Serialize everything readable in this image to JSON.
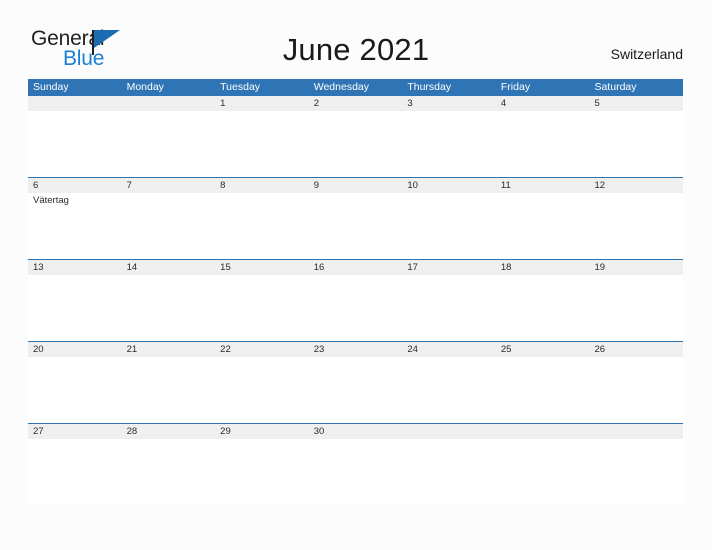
{
  "brand": {
    "name_part1": "General",
    "name_part2": "Blue",
    "flag_icon": "blue-triangle-flag-icon",
    "color_dark": "#231f20",
    "color_blue": "#1b7fd4"
  },
  "header": {
    "title": "June 2021",
    "country": "Switzerland"
  },
  "theme": {
    "header_blue": "#2f74b5",
    "date_band_gray": "#efefef",
    "page_background": "#fcfcfc",
    "text_color": "#2b2b2b"
  },
  "calendar": {
    "month": "June",
    "year": "2021",
    "weekdays": [
      "Sunday",
      "Monday",
      "Tuesday",
      "Wednesday",
      "Thursday",
      "Friday",
      "Saturday"
    ],
    "weeks": [
      [
        {
          "day": "",
          "event": ""
        },
        {
          "day": "",
          "event": ""
        },
        {
          "day": "1",
          "event": ""
        },
        {
          "day": "2",
          "event": ""
        },
        {
          "day": "3",
          "event": ""
        },
        {
          "day": "4",
          "event": ""
        },
        {
          "day": "5",
          "event": ""
        }
      ],
      [
        {
          "day": "6",
          "event": "Vätertag"
        },
        {
          "day": "7",
          "event": ""
        },
        {
          "day": "8",
          "event": ""
        },
        {
          "day": "9",
          "event": ""
        },
        {
          "day": "10",
          "event": ""
        },
        {
          "day": "11",
          "event": ""
        },
        {
          "day": "12",
          "event": ""
        }
      ],
      [
        {
          "day": "13",
          "event": ""
        },
        {
          "day": "14",
          "event": ""
        },
        {
          "day": "15",
          "event": ""
        },
        {
          "day": "16",
          "event": ""
        },
        {
          "day": "17",
          "event": ""
        },
        {
          "day": "18",
          "event": ""
        },
        {
          "day": "19",
          "event": ""
        }
      ],
      [
        {
          "day": "20",
          "event": ""
        },
        {
          "day": "21",
          "event": ""
        },
        {
          "day": "22",
          "event": ""
        },
        {
          "day": "23",
          "event": ""
        },
        {
          "day": "24",
          "event": ""
        },
        {
          "day": "25",
          "event": ""
        },
        {
          "day": "26",
          "event": ""
        }
      ],
      [
        {
          "day": "27",
          "event": ""
        },
        {
          "day": "28",
          "event": ""
        },
        {
          "day": "29",
          "event": ""
        },
        {
          "day": "30",
          "event": ""
        },
        {
          "day": "",
          "event": ""
        },
        {
          "day": "",
          "event": ""
        },
        {
          "day": "",
          "event": ""
        }
      ]
    ]
  }
}
